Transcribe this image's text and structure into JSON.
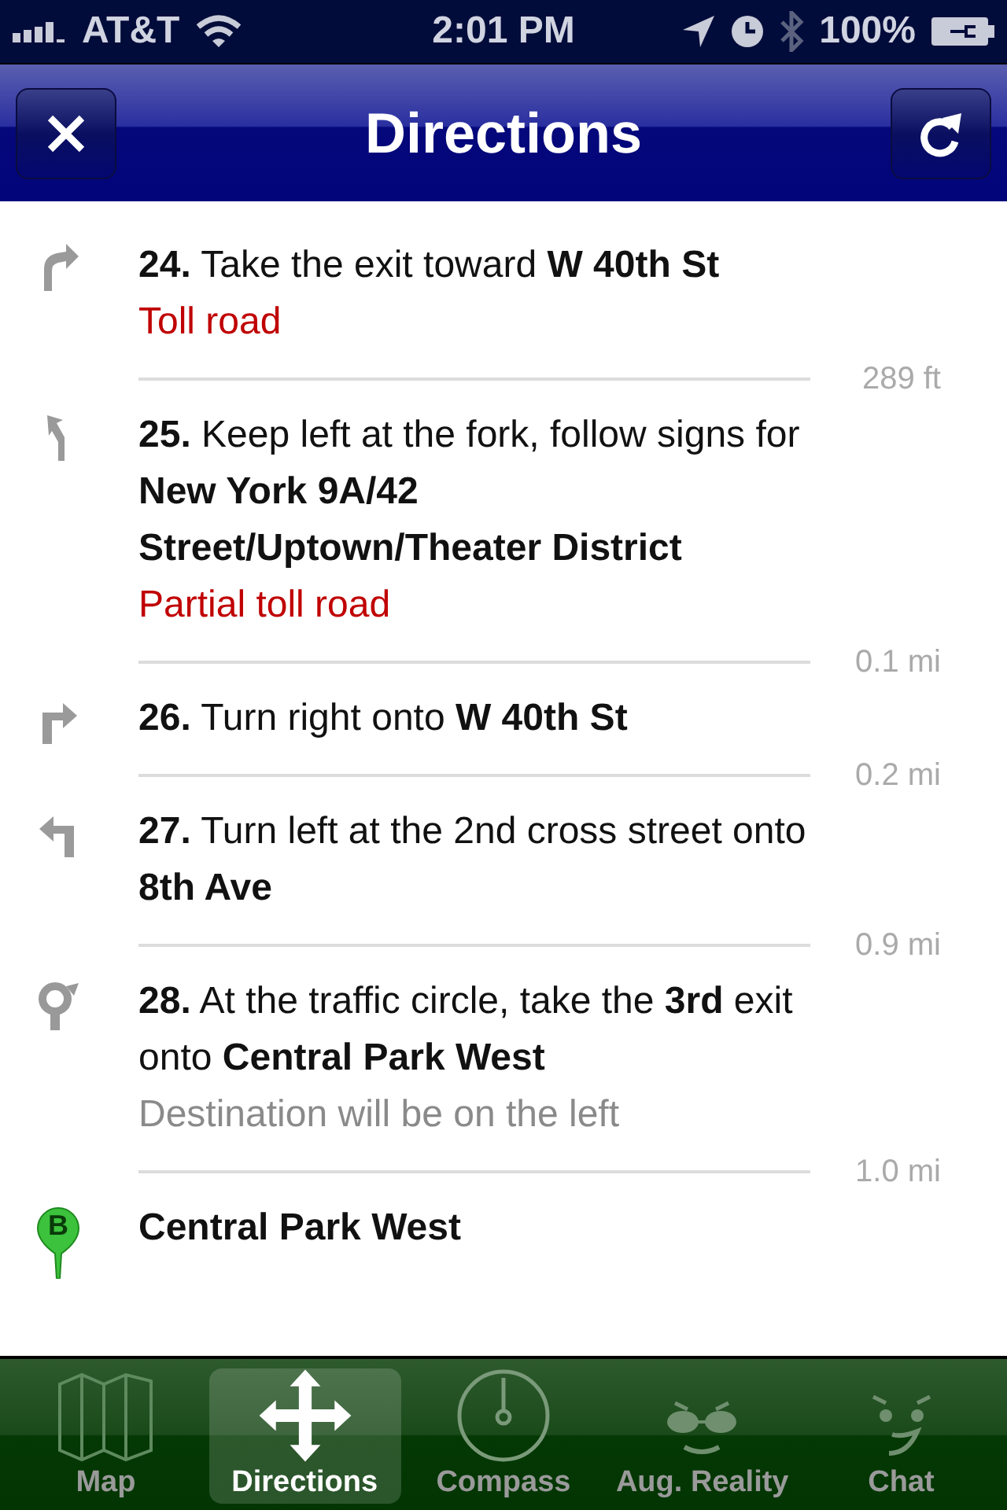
{
  "status_bar": {
    "carrier": "AT&T",
    "time": "2:01 PM",
    "battery": "100%"
  },
  "nav_bar": {
    "title": "Directions"
  },
  "steps": [
    {
      "kind": "slight-right",
      "text": "**24.** Take the exit toward **W 40th St**",
      "note": {
        "kind": "warning",
        "text": "Toll road"
      },
      "distance": "289 ft"
    },
    {
      "kind": "keep-left",
      "text": "**25.** Keep left at the fork, follow signs for **New York 9A/42 Street/Uptown/Theater District**",
      "note": {
        "kind": "warning",
        "text": "Partial toll road"
      },
      "distance": "0.1 mi"
    },
    {
      "kind": "right",
      "text": "**26.** Turn right onto **W 40th St**",
      "distance": "0.2 mi"
    },
    {
      "kind": "left",
      "text": "**27.** Turn left at the 2nd cross street onto **8th Ave**",
      "distance": "0.9 mi"
    },
    {
      "kind": "roundabout",
      "text": "**28.** At the traffic circle, take the **3rd** exit onto **Central Park West**",
      "note": {
        "kind": "info",
        "text": "Destination will be on the left"
      },
      "distance": "1.0 mi"
    }
  ],
  "destination": {
    "marker": "B",
    "text": "Central Park West"
  },
  "tabs": [
    {
      "label": "Map",
      "kind": "map",
      "selected": false
    },
    {
      "label": "Directions",
      "kind": "arrows",
      "selected": true
    },
    {
      "label": "Compass",
      "kind": "compass",
      "selected": false
    },
    {
      "label": "Aug. Reality",
      "kind": "glasses-face",
      "selected": false
    },
    {
      "label": "Chat",
      "kind": "face",
      "selected": false
    }
  ]
}
